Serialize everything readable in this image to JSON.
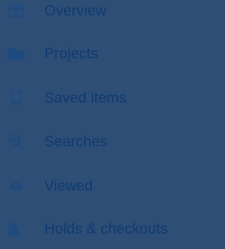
{
  "nav": {
    "items": [
      {
        "label": "Overview",
        "icon": "overview-icon"
      },
      {
        "label": "Projects",
        "icon": "folder-icon"
      },
      {
        "label": "Saved items",
        "icon": "bookmark-icon"
      },
      {
        "label": "Searches",
        "icon": "search-heart-icon"
      },
      {
        "label": "Viewed",
        "icon": "eye-icon"
      },
      {
        "label": "Holds & checkouts",
        "icon": "books-icon"
      }
    ]
  },
  "colors": {
    "background": "#2e4e75",
    "label": "#0f3b72",
    "icon": "#1e4a80"
  }
}
